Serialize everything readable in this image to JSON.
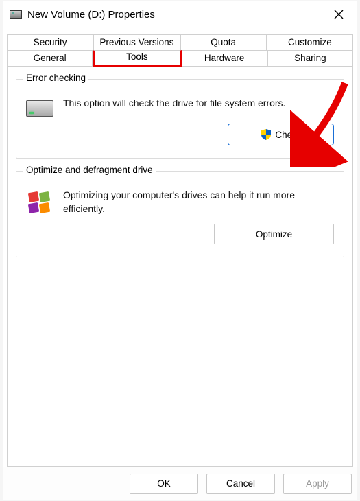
{
  "window": {
    "title": "New Volume (D:) Properties"
  },
  "tabs": {
    "row1": [
      "Security",
      "Previous Versions",
      "Quota",
      "Customize"
    ],
    "row2": [
      "General",
      "Tools",
      "Hardware",
      "Sharing"
    ],
    "active": "Tools"
  },
  "errorChecking": {
    "legend": "Error checking",
    "description": "This option will check the drive for file system errors.",
    "button": "Check"
  },
  "optimize": {
    "legend": "Optimize and defragment drive",
    "description": "Optimizing your computer's drives can help it run more efficiently.",
    "button": "Optimize"
  },
  "footer": {
    "ok": "OK",
    "cancel": "Cancel",
    "apply": "Apply"
  }
}
